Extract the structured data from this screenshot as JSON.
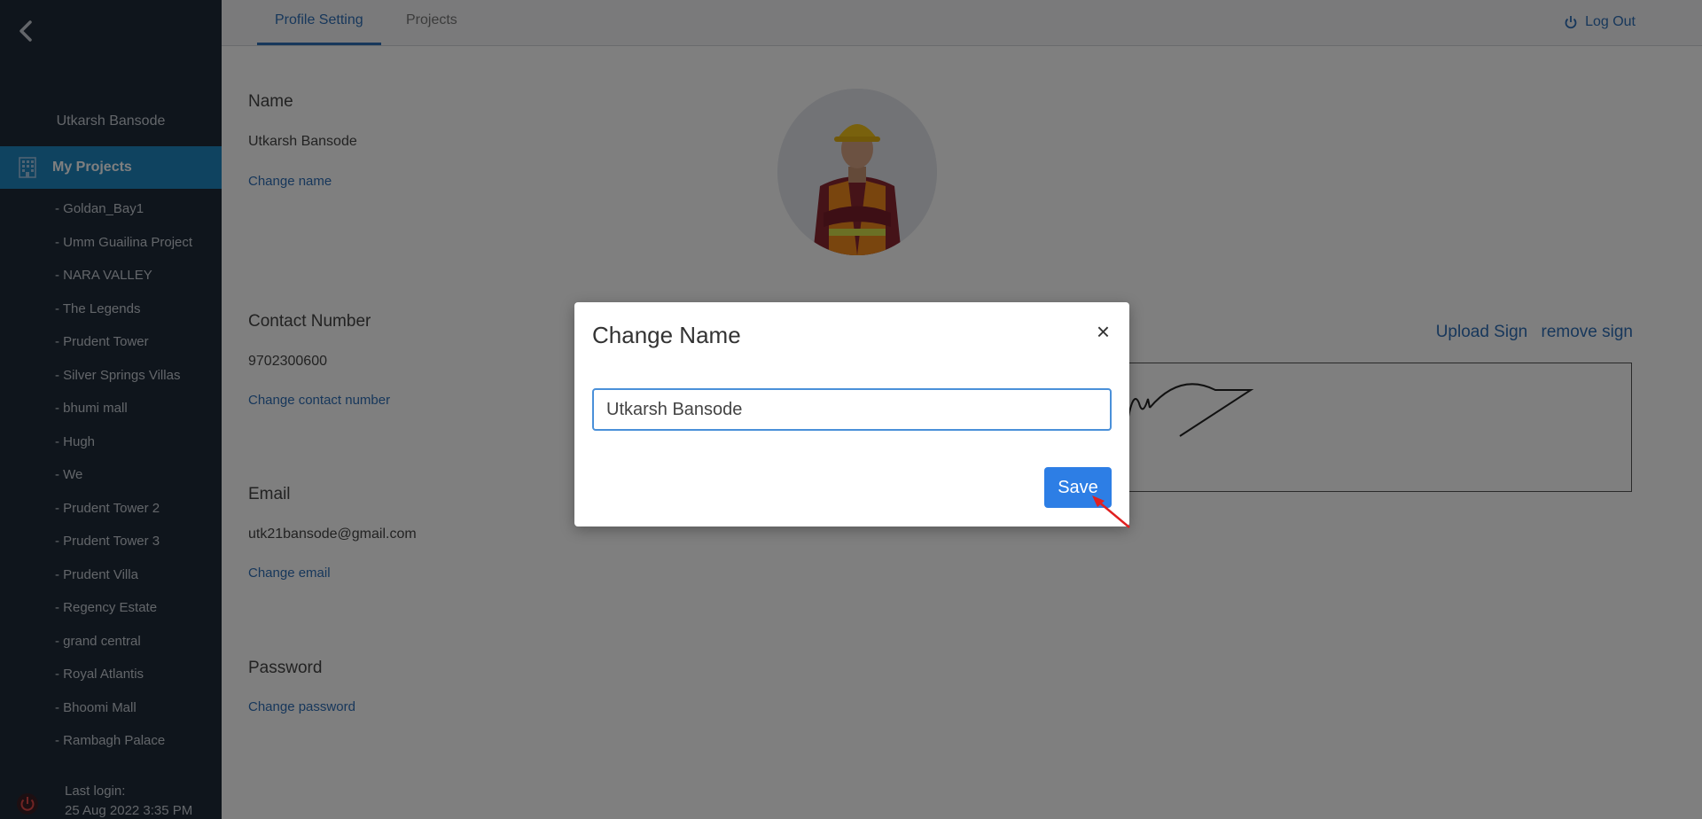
{
  "sidebar": {
    "user_name": "Utkarsh Bansode",
    "active_item": "My Projects",
    "projects": [
      "- Goldan_Bay1",
      "- Umm Guailina Project",
      "- NARA VALLEY",
      "- The Legends",
      "- Prudent Tower",
      "- Silver Springs Villas",
      "- bhumi mall",
      "- Hugh",
      "- We",
      "- Prudent Tower 2",
      "- Prudent Tower 3",
      "- Prudent Villa",
      "- Regency Estate",
      "- grand central",
      "- Royal Atlantis",
      "- Bhoomi Mall",
      "- Rambagh Palace"
    ],
    "last_login_label": "Last login:",
    "last_login_value": "25 Aug 2022 3:35 PM"
  },
  "header": {
    "tabs": [
      {
        "label": "Profile Setting",
        "active": true
      },
      {
        "label": "Projects",
        "active": false
      }
    ],
    "logout_label": "Log Out"
  },
  "profile": {
    "name_title": "Name",
    "name_value": "Utkarsh Bansode",
    "name_link": "Change name",
    "contact_title": "Contact Number",
    "contact_value": "9702300600",
    "contact_link": "Change contact number",
    "email_title": "Email",
    "email_value": "utk21bansode@gmail.com",
    "email_link": "Change email",
    "password_title": "Password",
    "password_link": "Change password",
    "upload_sign": "Upload Sign",
    "remove_sign": "remove sign"
  },
  "modal": {
    "title": "Change Name",
    "close": "×",
    "input_value": "Utkarsh Bansode",
    "save_label": "Save"
  },
  "colors": {
    "sidebar_bg": "#1f2b39",
    "sidebar_active": "#1e86c0",
    "link": "#2f6fb7",
    "primary_button": "#2d7ee5"
  },
  "icons": [
    "chevron-left-icon",
    "building-icon",
    "power-icon",
    "logout-power-icon",
    "close-icon",
    "arrow-pointer-icon"
  ]
}
